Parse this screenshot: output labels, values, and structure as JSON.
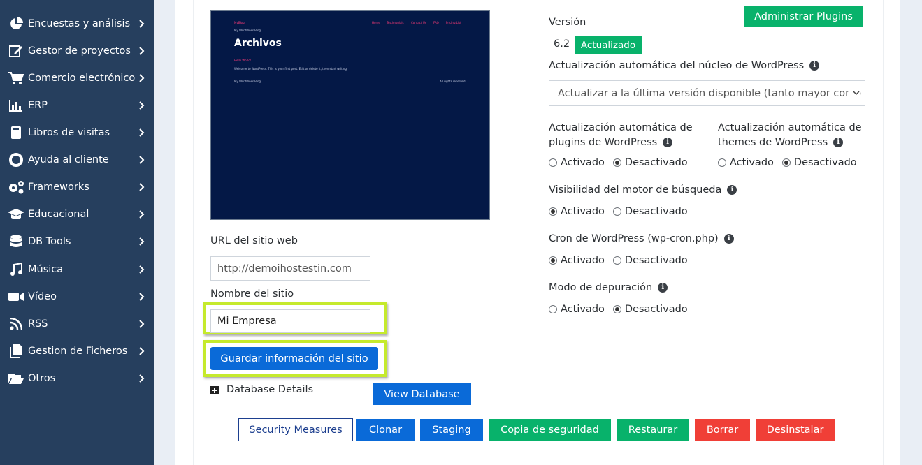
{
  "sidebar": {
    "items": [
      {
        "label": "Encuestas y análisis",
        "icon": "pie-chart-icon"
      },
      {
        "label": "Gestor de proyectos",
        "icon": "edit-icon"
      },
      {
        "label": "Comercio electrónico",
        "icon": "cart-icon"
      },
      {
        "label": "ERP",
        "icon": "bar-chart-icon"
      },
      {
        "label": "Libros de visitas",
        "icon": "book-icon"
      },
      {
        "label": "Ayuda al cliente",
        "icon": "lifebuoy-icon"
      },
      {
        "label": "Frameworks",
        "icon": "gears-icon"
      },
      {
        "label": "Educacional",
        "icon": "graduation-cap-icon"
      },
      {
        "label": "DB Tools",
        "icon": "database-icon"
      },
      {
        "label": "Música",
        "icon": "music-icon"
      },
      {
        "label": "Vídeo",
        "icon": "video-icon"
      },
      {
        "label": "RSS",
        "icon": "rss-icon"
      },
      {
        "label": "Gestion de Ficheros",
        "icon": "file-icon"
      },
      {
        "label": "Otros",
        "icon": "folder-icon"
      }
    ]
  },
  "preview": {
    "brand": "MyBlog",
    "subtitle": "My WordPress Blog",
    "nav": [
      "Home",
      "Testimonials",
      "Contact Us",
      "FAQ",
      "Pricing List"
    ],
    "heading": "Archivos",
    "post_link": "Hello World!",
    "welcome": "Welcome to WordPress. This is your first post. Edit or delete it, then start writing!",
    "footer_left": "My WordPress Blog",
    "footer_right": "All rights reserved"
  },
  "site": {
    "url_label": "URL del sitio web",
    "url_value": "http://demoihostestin.com",
    "name_label": "Nombre del sitio",
    "name_value": "Mi Empresa",
    "save_button": "Guardar información del sitio",
    "db_details": "Database Details",
    "view_db_button": "View Database"
  },
  "settings": {
    "manage_plugins_button": "Administrar Plugins",
    "version_label": "Versión",
    "version_value": "6.2",
    "updated_badge": "Actualizado",
    "core_update_label": "Actualización automática del núcleo de WordPress",
    "core_update_selected": "Actualizar a la última versión disponible (tanto mayor como menor)",
    "plugins_update_label_line1": "Actualización automática de",
    "plugins_update_label_line2": "plugins de WordPress",
    "themes_update_label_line1": "Actualización automática de",
    "themes_update_label_line2": "themes de WordPress",
    "search_visibility_label": "Visibilidad del motor de búsqueda",
    "cron_label": "Cron de WordPress (wp-cron.php)",
    "debug_label": "Modo de depuración",
    "opt_on": "Activado",
    "opt_off": "Desactivado",
    "plugins_update": "Desactivado",
    "themes_update": "Desactivado",
    "search_visibility": "Activado",
    "cron": "Activado",
    "debug": "Desactivado"
  },
  "actions": {
    "security": "Security Measures",
    "clone": "Clonar",
    "staging": "Staging",
    "backup": "Copia de seguridad",
    "restore": "Restaurar",
    "delete": "Borrar",
    "uninstall": "Desinstalar"
  },
  "colors": {
    "sidebar_bg": "#263f5e",
    "blue": "#0a6ad8",
    "green": "#08b26b",
    "red": "#f03f37",
    "highlight": "#c5ea2c"
  }
}
